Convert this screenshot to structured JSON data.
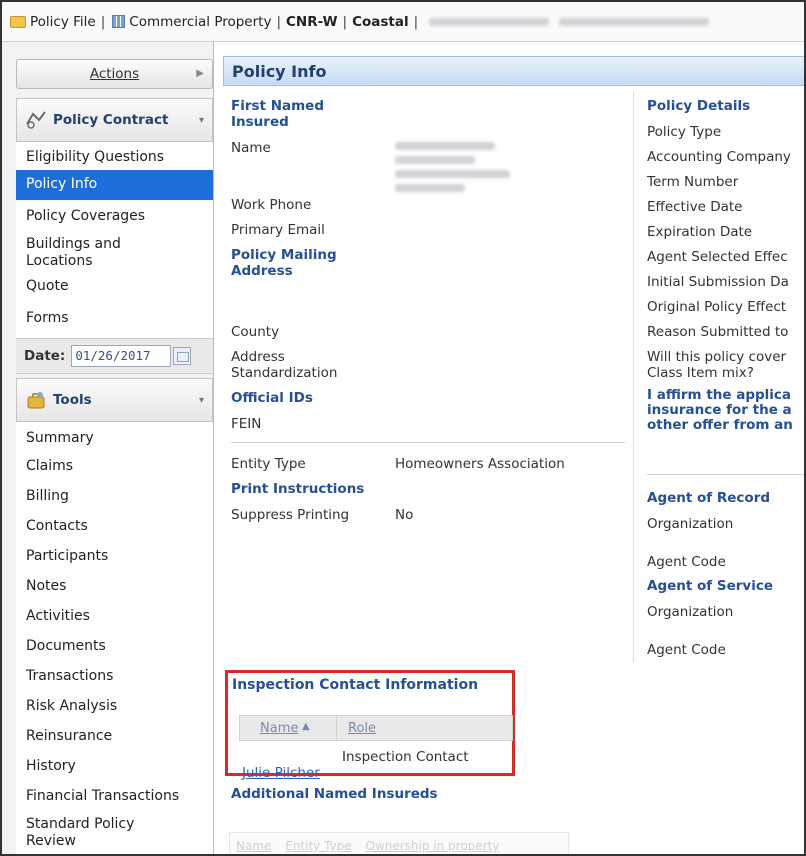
{
  "topbar": {
    "policy_file": "Policy File",
    "product": "Commercial Property",
    "code": "CNR-W",
    "region": "Coastal"
  },
  "sidebar": {
    "actions_label": "Actions",
    "policy_contract_title": "Policy Contract",
    "policy_items": [
      "Eligibility Questions",
      "Policy Info",
      "Policy Coverages",
      "Buildings and\nLocations",
      "Quote",
      "Forms"
    ],
    "selected_item": "Policy Info",
    "date_label": "Date:",
    "date_value": "01/26/2017",
    "tools_title": "Tools",
    "tool_items": [
      "Summary",
      "Claims",
      "Billing",
      "Contacts",
      "Participants",
      "Notes",
      "Activities",
      "Documents",
      "Transactions",
      "Risk Analysis",
      "Reinsurance",
      "History",
      "Financial Transactions",
      "Standard Policy\nReview"
    ]
  },
  "main": {
    "title": "Policy Info",
    "left": {
      "first_named_insured": "First Named\nInsured",
      "name": "Name",
      "work_phone": "Work Phone",
      "primary_email": "Primary Email",
      "mailing_address": "Policy Mailing\nAddress",
      "county": "County",
      "address_std": "Address\nStandardization",
      "official_ids": "Official IDs",
      "fein": "FEIN",
      "entity_type_label": "Entity Type",
      "entity_type_value": "Homeowners Association",
      "print_instructions": "Print Instructions",
      "suppress_printing_label": "Suppress Printing",
      "suppress_printing_value": "No"
    },
    "right": {
      "policy_details": "Policy Details",
      "fields": [
        "Policy Type",
        "Accounting Company",
        "Term Number",
        "Effective Date",
        "Expiration Date",
        "Agent Selected Effec",
        "Initial Submission Da",
        "Original Policy Effect",
        "Reason Submitted to",
        "Will this policy cover\nClass Item mix?"
      ],
      "affirm": "I affirm the applica\ninsurance for the a\nother offer from an",
      "agent_of_record": "Agent of Record",
      "aor_org": "Organization",
      "aor_code": "Agent Code",
      "agent_of_service": "Agent of Service",
      "aos_org": "Organization",
      "aos_code": "Agent Code"
    },
    "inspection": {
      "title": "Inspection Contact Information",
      "col_name": "Name",
      "col_role": "Role",
      "row_name": "Julie Pilcher",
      "row_role": "Inspection Contact"
    },
    "additional": {
      "title": "Additional Named Insureds",
      "columns": [
        "Name",
        "Entity Type",
        "Ownership in property"
      ]
    }
  }
}
